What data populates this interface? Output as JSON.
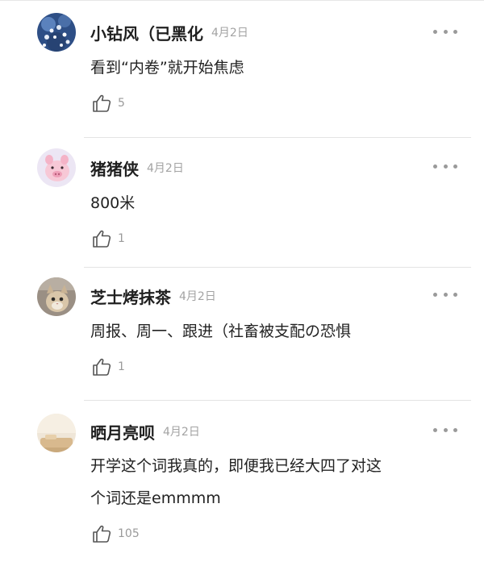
{
  "comments": [
    {
      "username": "小钻风（已黑化",
      "date": "4月2日",
      "text": "看到“内卷”就开始焦虑",
      "likes": "5",
      "avatar": "flowers-avatar"
    },
    {
      "username": "猪猪侠",
      "date": "4月2日",
      "text": "800米",
      "likes": "1",
      "avatar": "pig-avatar"
    },
    {
      "username": "芝士烤抹茶",
      "date": "4月2日",
      "text": "周报、周一、跟进（社畜被支配の恐惧",
      "likes": "1",
      "avatar": "cat-avatar"
    },
    {
      "username": "晒月亮呗",
      "date": "4月2日",
      "text_line1": "开学这个词我真的，即便我已经大四了对这",
      "text_line2": "个词还是emmmm",
      "likes": "105",
      "avatar": "room-avatar"
    }
  ],
  "icons": {
    "like": "thumbs-up-icon",
    "more": "more-dots-icon"
  },
  "colors": {
    "name": "#1f1f1f",
    "date": "#a3a3a3",
    "muted": "#9a9a9a",
    "divider": "#e4e4e4"
  }
}
